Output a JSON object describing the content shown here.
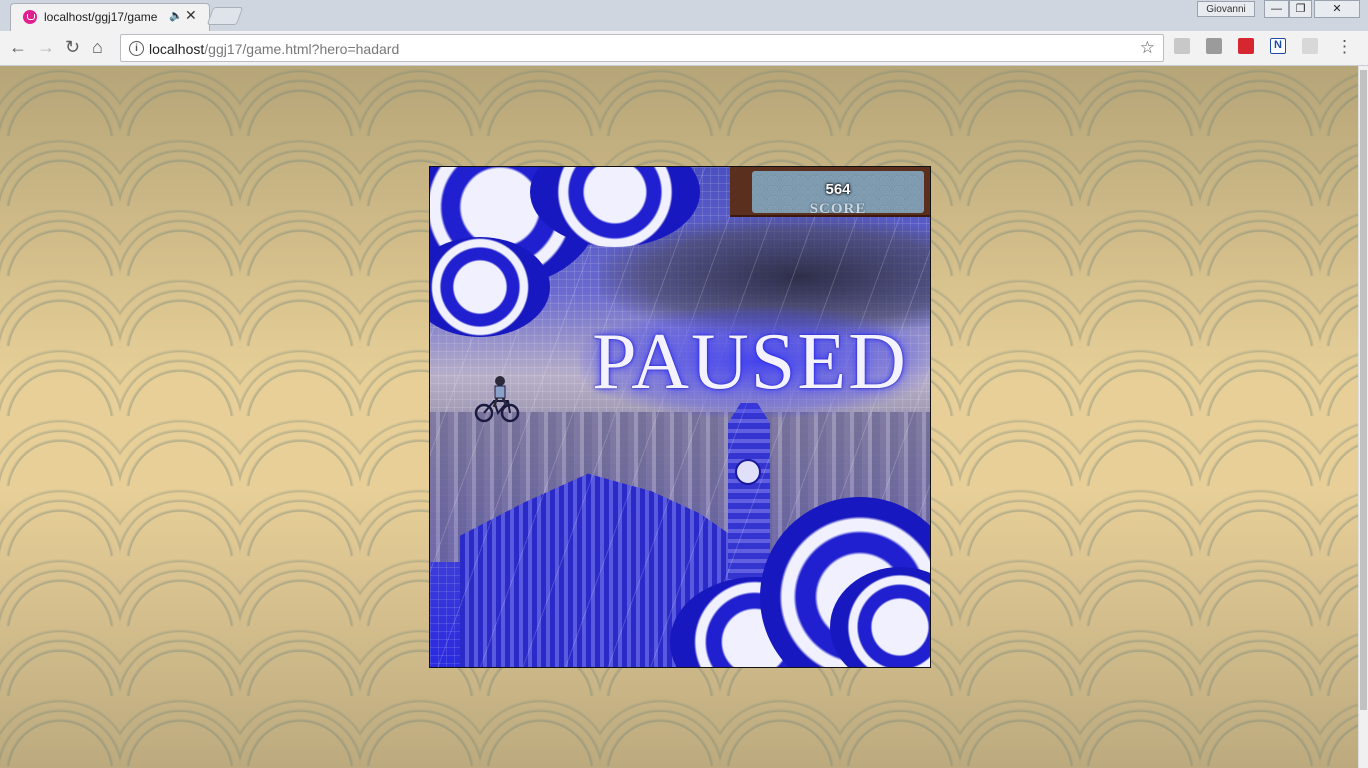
{
  "browser": {
    "tab": {
      "title": "localhost/ggj17/game",
      "audio_icon": "speaker-icon",
      "close_glyph": "✕"
    },
    "profile_name": "Giovanni",
    "window_controls": {
      "minimize": "—",
      "maximize": "❐",
      "close": "✕"
    },
    "nav": {
      "back": "←",
      "forward": "→",
      "reload": "↻",
      "home": "⌂"
    },
    "url": {
      "host": "localhost",
      "path": "/ggj17/game.html?hero=hadard"
    },
    "bookmark_glyph": "☆",
    "extensions": [
      "drive-icon",
      "archive-icon",
      "pdf-red-icon",
      "notes-icon",
      "acrobat-icon"
    ],
    "extension_label_n": "N",
    "menu_glyph": "⋮"
  },
  "game": {
    "score_value": "564",
    "score_label": "SCORE",
    "paused_text": "PAUSED"
  },
  "colors": {
    "accent_wave": "#2020d0",
    "score_panel": "#5a2f1e",
    "background_tan": "#e7cf97"
  }
}
